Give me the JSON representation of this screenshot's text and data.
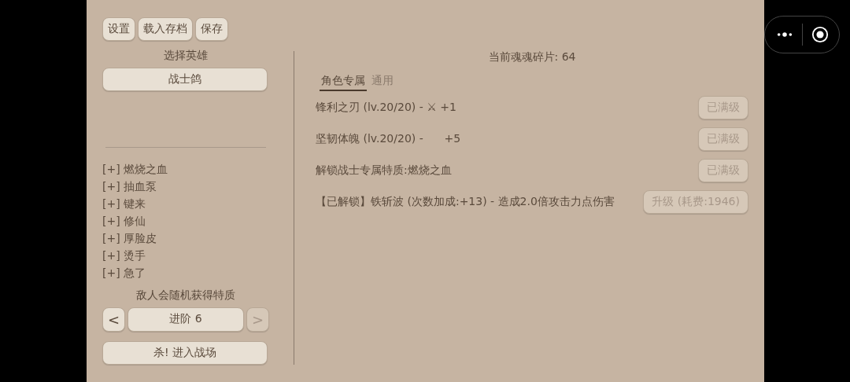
{
  "top_buttons": [
    {
      "label": "设置"
    },
    {
      "label": "载入存档"
    },
    {
      "label": "保存"
    }
  ],
  "hero": {
    "heading": "选择英雄",
    "selected_hero": "战士鸽"
  },
  "traits": [
    "[+] 燃烧之血",
    "[+] 抽血泵",
    "[+] 键来",
    "[+] 修仙",
    "[+] 厚脸皮",
    "[+] 烫手",
    "[+] 急了"
  ],
  "difficulty": {
    "note": "敌人会随机获得特质",
    "prev": {
      "label": "<",
      "disabled": false
    },
    "level": "进阶 6",
    "next": {
      "label": ">",
      "disabled": true
    }
  },
  "start_button": "杀! 进入战场",
  "shards": "当前魂魂碎片: 64",
  "tabs": [
    {
      "label": "角色专属",
      "selected": true
    },
    {
      "label": "通用",
      "selected": false
    }
  ],
  "upgrades": [
    {
      "text": "锋利之刃 (lv.20/20) - ⚔ +1",
      "button": "已满级",
      "disabled": true
    },
    {
      "text": "坚韧体魄 (lv.20/20) -      +5",
      "button": "已满级",
      "disabled": true
    },
    {
      "text": "解锁战士专属特质:燃烧之血",
      "button": "已满级",
      "disabled": true
    },
    {
      "text": "【已解锁】铁斩波 (次数加成:+13) - 造成2.0倍攻击力点伤害",
      "button": "升级 (耗费:1946)",
      "disabled": true
    }
  ]
}
